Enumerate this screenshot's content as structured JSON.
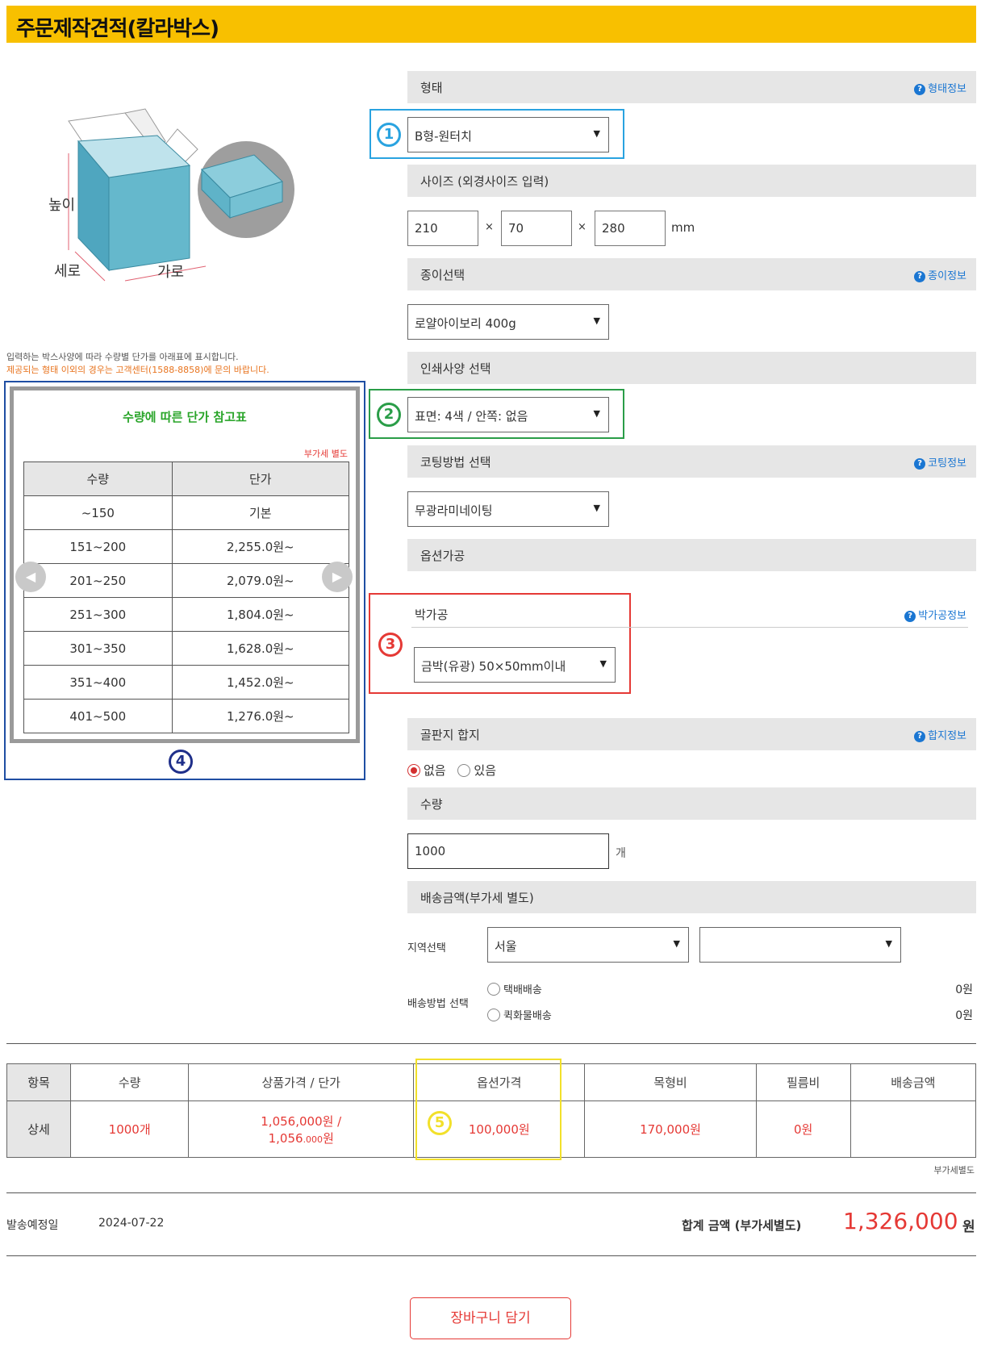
{
  "header": {
    "title": "주문제작견적(칼라박스)"
  },
  "illustration": {
    "height_label": "높이",
    "depth_label": "세로",
    "width_label": "가로"
  },
  "notes": {
    "line1": "입력하는 박스사양에 따라 수량별 단가를 아래표에 표시합니다.",
    "line2": "제공되는 형태 이외의 경우는 고객센터(1588-8858)에 문의 바랍니다."
  },
  "reference": {
    "title": "수량에 따른 단가 참고표",
    "vat_note": "부가세 별도",
    "headers": [
      "수량",
      "단가"
    ],
    "rows": [
      [
        "~150",
        "기본"
      ],
      [
        "151~200",
        "2,255.0원~"
      ],
      [
        "201~250",
        "2,079.0원~"
      ],
      [
        "251~300",
        "1,804.0원~"
      ],
      [
        "301~350",
        "1,628.0원~"
      ],
      [
        "351~400",
        "1,452.0원~"
      ],
      [
        "401~500",
        "1,276.0원~"
      ]
    ],
    "prev_icon": "◀",
    "next_icon": "▶"
  },
  "markers": {
    "m1": "1",
    "m2": "2",
    "m3": "3",
    "m4": "4",
    "m5": "5"
  },
  "form": {
    "shape": {
      "label": "형태",
      "info": "형태정보",
      "value": "B형-원터치"
    },
    "size": {
      "label": "사이즈  (외경사이즈 입력)",
      "w": "210",
      "d": "70",
      "h": "280",
      "unit": "mm",
      "times": "×"
    },
    "paper": {
      "label": "종이선택",
      "info": "종이정보",
      "value": "로얄아이보리 400g"
    },
    "print": {
      "label": "인쇄사양 선택",
      "value": "표면: 4색 / 안쪽: 없음"
    },
    "coating": {
      "label": "코팅방법 선택",
      "info": "코팅정보",
      "value": "무광라미네이팅"
    },
    "option": {
      "label": "옵션가공"
    },
    "foil": {
      "label": "박가공",
      "info": "박가공정보",
      "value": "금박(유광) 50×50mm이내"
    },
    "corrugated": {
      "label": "골판지 합지",
      "info": "합지정보",
      "opt_no": "없음",
      "opt_yes": "있음"
    },
    "quantity": {
      "label": "수량",
      "value": "1000",
      "unit": "개"
    },
    "shipping": {
      "label": "배송금액(부가세 별도)",
      "region_label": "지역선택",
      "region_value": "서울",
      "region2_value": "",
      "method_label": "배송방법 선택",
      "method1": "택배배송",
      "method1_price": "0원",
      "method2": "퀵화물배송",
      "method2_price": "0원"
    }
  },
  "summary": {
    "headers": [
      "항목",
      "수량",
      "상품가격 / 단가",
      "옵션가격",
      "목형비",
      "필름비",
      "배송금액"
    ],
    "row_label": "상세",
    "qty": "1000개",
    "price_line1": "1,056,000원 /",
    "price_line2_main": "1,056",
    "price_line2_dec": ".000",
    "price_line2_unit": "원",
    "option_price": "100,000원",
    "mold": "170,000원",
    "film": "0원",
    "ship": "",
    "vat_note": "부가세별도"
  },
  "ship_date": {
    "label": "발송예정일",
    "value": "2024-07-22"
  },
  "total": {
    "label": "합계 금액 (부가세별도)",
    "value": "1,326,000",
    "unit": "원"
  },
  "cart_button": "장바구니 담기",
  "colors": {
    "header": "#f8c000",
    "accent_red": "#e53935",
    "link_blue": "#1a76d2"
  }
}
